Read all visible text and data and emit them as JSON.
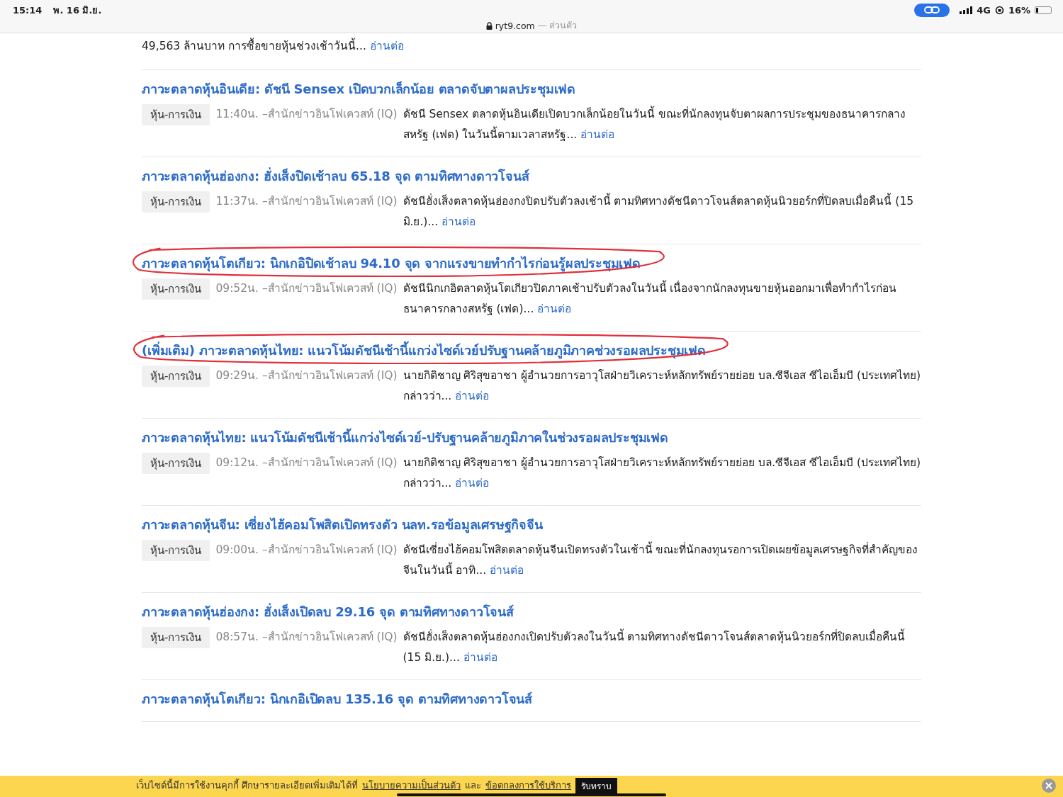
{
  "status_bar": {
    "time": "15:14",
    "date": "พ. 16 มิ.ย.",
    "network": "4G",
    "battery": "16%"
  },
  "address_bar": {
    "domain": "ryt9.com",
    "mode": "— ส่วนตัว"
  },
  "top_snippet": {
    "text": "49,563 ล้านบาท การซื้อขายหุ้นช่วงเช้าวันนี้...",
    "link": "อ่านต่อ"
  },
  "articles": [
    {
      "title": "ภาวะตลาดหุ้นอินเดีย: ดัชนี Sensex เปิดบวกเล็กน้อย ตลาดจับตาผลประชุมเฟด",
      "circled": false,
      "tag": "หุ้น-การเงิน",
      "time": "11:40น.",
      "source": "–สำนักข่าวอินโฟเควสท์ (IQ)",
      "summary": "ดัชนี Sensex ตลาดหุ้นอินเดียเปิดบวกเล็กน้อยในวันนี้ ขณะที่นักลงทุนจับตาผลการประชุมของธนาคารกลางสหรัฐ (เฟด) ในวันนี้ตามเวลาสหรัฐ...",
      "link": "อ่านต่อ"
    },
    {
      "title": "ภาวะตลาดหุ้นฮ่องกง: ฮั่งเส็งปิดเช้าลบ 65.18 จุด ตามทิศทางดาวโจนส์",
      "circled": false,
      "tag": "หุ้น-การเงิน",
      "time": "11:37น.",
      "source": "–สำนักข่าวอินโฟเควสท์ (IQ)",
      "summary": "ดัชนีฮั่งเส็งตลาดหุ้นฮ่องกงปิดปรับตัวลงเช้านี้ ตามทิศทางดัชนีดาวโจนส์ตลาดหุ้นนิวยอร์กที่ปิดลบเมื่อคืนนี้ (15 มิ.ย.)...",
      "link": "อ่านต่อ"
    },
    {
      "title": "ภาวะตลาดหุ้นโตเกียว: นิกเกอิปิดเช้าลบ 94.10 จุด จากแรงขายทำกำไรก่อนรู้ผลประชุมเฟด",
      "circled": true,
      "tag": "หุ้น-การเงิน",
      "time": "09:52น.",
      "source": "–สำนักข่าวอินโฟเควสท์ (IQ)",
      "summary": "ดัชนีนิกเกอิตลาดหุ้นโตเกียวปิดภาคเช้าปรับตัวลงในวันนี้ เนื่องจากนักลงทุนขายหุ้นออกมาเพื่อทำกำไรก่อนธนาคารกลางสหรัฐ (เฟด)...",
      "link": "อ่านต่อ"
    },
    {
      "title": "(เพิ่มเติม) ภาวะตลาดหุ้นไทย: แนวโน้มดัชนีเช้านี้แกว่งไซด์เวย์ปรับฐานคล้ายภูมิภาคช่วงรอผลประชุมเฟด",
      "circled": true,
      "tag": "หุ้น-การเงิน",
      "time": "09:29น.",
      "source": "–สำนักข่าวอินโฟเควสท์ (IQ)",
      "summary": "นายกิติชาญ ศิริสุขอาชา ผู้อำนวยการอาวุโสฝ่ายวิเคราะห์หลักทรัพย์รายย่อย บล.ซีจีเอส ซีไอเอ็มบี (ประเทศไทย) กล่าวว่า...",
      "link": "อ่านต่อ"
    },
    {
      "title": "ภาวะตลาดหุ้นไทย: แนวโน้มดัชนีเช้านี้แกว่งไซด์เวย์-ปรับฐานคล้ายภูมิภาคในช่วงรอผลประชุมเฟด",
      "circled": false,
      "tag": "หุ้น-การเงิน",
      "time": "09:12น.",
      "source": "–สำนักข่าวอินโฟเควสท์ (IQ)",
      "summary": "นายกิติชาญ ศิริสุขอาชา ผู้อำนวยการอาวุโสฝ่ายวิเคราะห์หลักทรัพย์รายย่อย บล.ซีจีเอส ซีไอเอ็มบี (ประเทศไทย) กล่าวว่า...",
      "link": "อ่านต่อ"
    },
    {
      "title": "ภาวะตลาดหุ้นจีน: เซี่ยงไฮ้คอมโพสิตเปิดทรงตัว นลท.รอข้อมูลเศรษฐกิจจีน",
      "circled": false,
      "tag": "หุ้น-การเงิน",
      "time": "09:00น.",
      "source": "–สำนักข่าวอินโฟเควสท์ (IQ)",
      "summary": "ดัชนีเซี่ยงไฮ้คอมโพสิตตลาดหุ้นจีนเปิดทรงตัวในเช้านี้ ขณะที่นักลงทุนรอการเปิดเผยข้อมูลเศรษฐกิจที่สำคัญของจีนในวันนี้ อาทิ...",
      "link": "อ่านต่อ"
    },
    {
      "title": "ภาวะตลาดหุ้นฮ่องกง: ฮั่งเส็งเปิดลบ 29.16 จุด ตามทิศทางดาวโจนส์",
      "circled": false,
      "tag": "หุ้น-การเงิน",
      "time": "08:57น.",
      "source": "–สำนักข่าวอินโฟเควสท์ (IQ)",
      "summary": "ดัชนีฮั่งเส็งตลาดหุ้นฮ่องกงเปิดปรับตัวลงในวันนี้ ตามทิศทางดัชนีดาวโจนส์ตลาดหุ้นนิวยอร์กที่ปิดลบเมื่อคืนนี้ (15 มิ.ย.)...",
      "link": "อ่านต่อ"
    },
    {
      "title": "ภาวะตลาดหุ้นโตเกียว: นิกเกอิเปิดลบ 135.16 จุด ตามทิศทางดาวโจนส์",
      "circled": false
    }
  ],
  "cookie_banner": {
    "text": "เว็บไซต์นี้มีการใช้งานคุกกี้ ศึกษารายละเอียดเพิ่มเติมได้ที่",
    "privacy_link": "นโยบายความเป็นส่วนตัว",
    "and": "และ",
    "terms_link": "ข้อตกลงการใช้บริการ",
    "button": "รับทราบ"
  }
}
